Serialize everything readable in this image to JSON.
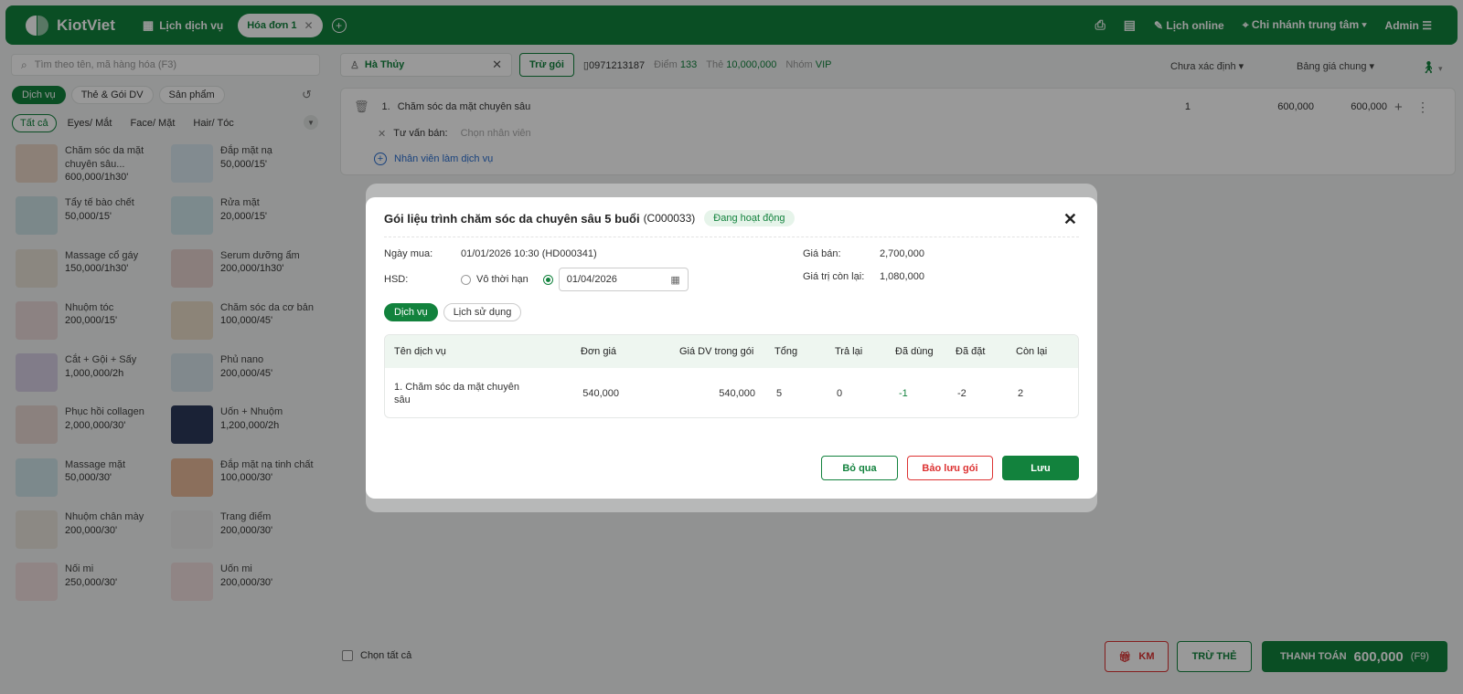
{
  "app": {
    "brand": "KiotViet",
    "nav_schedule": "Lịch dịch vụ",
    "tab_invoice": "Hóa đơn 1",
    "online": "Lịch online",
    "branch": "Chi nhánh trung tâm",
    "admin": "Admin"
  },
  "left": {
    "search_placeholder": "Tìm theo tên, mã hàng hóa (F3)",
    "cats": [
      "Dịch vụ",
      "Thẻ & Gói DV",
      "Sản phẩm"
    ],
    "subcats": [
      "Tất cả",
      "Eyes/ Mắt",
      "Face/ Mặt",
      "Hair/ Tóc"
    ],
    "products": [
      {
        "name": "Chăm sóc da mặt chuyên sâu...",
        "price": "600,000/1h30'"
      },
      {
        "name": "Đắp mặt nạ",
        "price": "50,000/15'"
      },
      {
        "name": "Tẩy tế bào chết",
        "price": "50,000/15'"
      },
      {
        "name": "Rửa mặt",
        "price": "20,000/15'"
      },
      {
        "name": "Massage cổ gáy",
        "price": "150,000/1h30'"
      },
      {
        "name": "Serum dưỡng ẩm",
        "price": "200,000/1h30'"
      },
      {
        "name": "Nhuộm tóc",
        "price": "200,000/15'"
      },
      {
        "name": "Chăm sóc da cơ bản",
        "price": "100,000/45'"
      },
      {
        "name": "Cắt + Gội + Sấy",
        "price": "1,000,000/2h"
      },
      {
        "name": "Phủ nano",
        "price": "200,000/45'"
      },
      {
        "name": "Phục hồi collagen",
        "price": "2,000,000/30'"
      },
      {
        "name": "Uốn + Nhuộm",
        "price": "1,200,000/2h"
      },
      {
        "name": "Massage mặt",
        "price": "50,000/30'"
      },
      {
        "name": "Đắp mặt nạ tinh chất",
        "price": "100,000/30'"
      },
      {
        "name": "Nhuộm chân mày",
        "price": "200,000/30'"
      },
      {
        "name": "Trang điểm",
        "price": "200,000/30'"
      },
      {
        "name": "Nối mi",
        "price": "250,000/30'"
      },
      {
        "name": "Uốn mi",
        "price": "200,000/30'"
      }
    ]
  },
  "customer": {
    "name": "Hà Thủy",
    "deduct_btn": "Trừ gói",
    "phone": "0971213187",
    "points_label": "Điểm",
    "points": "133",
    "card_label": "Thẻ",
    "card": "10,000,000",
    "group_label": "Nhóm",
    "group": "VIP",
    "status_dd": "Chưa xác định",
    "pricebook_dd": "Bảng giá chung"
  },
  "item": {
    "index": "1.",
    "name": "Chăm sóc da mặt chuyên sâu",
    "qty": "1",
    "price": "600,000",
    "total": "600,000",
    "advisor_label": "Tư vấn bán:",
    "advisor_ph": "Chọn nhân viên",
    "staff_link": "Nhân viên làm dịch vụ"
  },
  "bottom": {
    "select_all": "Chọn tất cả",
    "km": "KM",
    "tru_the": "TRỪ THẺ",
    "pay_label": "THANH TOÁN",
    "pay_amount": "600,000",
    "pay_key": "(F9)"
  },
  "modal": {
    "title": "Gói liệu trình chăm sóc da chuyên sâu 5 buổi",
    "code": "(C000033)",
    "status": "Đang hoạt động",
    "buy_label": "Ngày mua:",
    "buy_value": "01/01/2026 10:30 (HD000341)",
    "hsd_label": "HSD:",
    "unlimited": "Vô thời hạn",
    "date": "01/04/2026",
    "sell_label": "Giá bán:",
    "sell_value": "2,700,000",
    "remain_label": "Giá trị còn lại:",
    "remain_value": "1,080,000",
    "tabs": [
      "Dịch vụ",
      "Lịch sử dụng"
    ],
    "headers": [
      "Tên dịch vụ",
      "Đơn giá",
      "Giá DV trong gói",
      "Tổng",
      "Trả lại",
      "Đã dùng",
      "Đã đặt",
      "Còn lại"
    ],
    "row": [
      "1. Chăm sóc da mặt chuyên sâu",
      "540,000",
      "540,000",
      "5",
      "0",
      "-1",
      "-2",
      "2"
    ],
    "skip": "Bỏ qua",
    "reserve": "Bảo lưu gói",
    "save": "Lưu"
  },
  "colors": {
    "brand": "#12823d",
    "danger": "#dd3333"
  }
}
